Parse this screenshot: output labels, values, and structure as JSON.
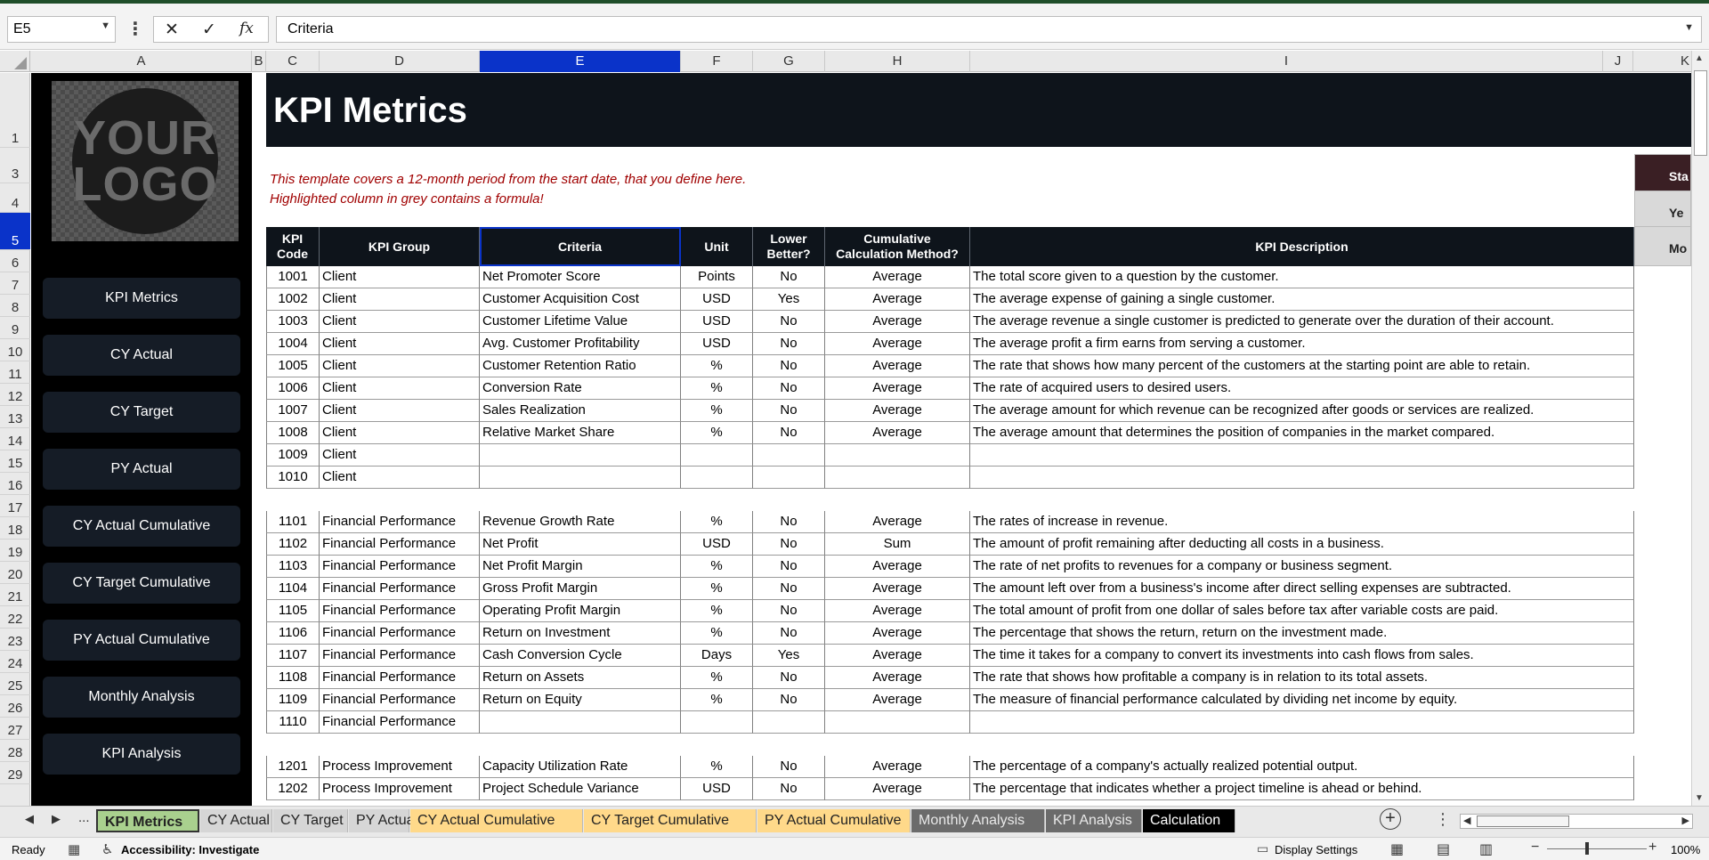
{
  "formula_bar": {
    "name_box": "E5",
    "formula": "Criteria"
  },
  "column_headers": [
    "A",
    "B",
    "C",
    "D",
    "E",
    "F",
    "G",
    "H",
    "I",
    "J",
    "K"
  ],
  "row_numbers": [
    "1",
    "3",
    "4",
    "5",
    "6",
    "7",
    "8",
    "9",
    "10",
    "11",
    "12",
    "13",
    "14",
    "15",
    "16",
    "17",
    "18",
    "19",
    "20",
    "21",
    "22",
    "23",
    "24",
    "25",
    "26",
    "27",
    "28",
    "29"
  ],
  "sidebar": {
    "logo_line1": "YOUR",
    "logo_line2": "LOGO",
    "items": [
      "KPI Metrics",
      "CY Actual",
      "CY Target",
      "PY Actual",
      "CY Actual Cumulative",
      "CY Target Cumulative",
      "PY Actual Cumulative",
      "Monthly Analysis",
      "KPI Analysis"
    ]
  },
  "sheet": {
    "title": "KPI Metrics",
    "note1": "This template covers a 12-month period from the start date, that you define here.",
    "note2": "Highlighted column in grey contains a formula!",
    "side_panel": [
      "Sta",
      "Ye",
      "Mo"
    ]
  },
  "table": {
    "headers": {
      "code_line1": "KPI",
      "code_line2": "Code",
      "group": "KPI Group",
      "criteria": "Criteria",
      "unit": "Unit",
      "lower_line1": "Lower",
      "lower_line2": "Better?",
      "cum_line1": "Cumulative",
      "cum_line2": "Calculation Method?",
      "desc": "KPI Description"
    },
    "rows": [
      {
        "code": "1001",
        "group": "Client",
        "criteria": "Net Promoter Score",
        "unit": "Points",
        "lower": "No",
        "method": "Average",
        "desc": "The total score given to a question by the customer."
      },
      {
        "code": "1002",
        "group": "Client",
        "criteria": "Customer Acquisition Cost",
        "unit": "USD",
        "lower": "Yes",
        "method": "Average",
        "desc": "The average expense of gaining a single customer."
      },
      {
        "code": "1003",
        "group": "Client",
        "criteria": "Customer Lifetime Value",
        "unit": "USD",
        "lower": "No",
        "method": "Average",
        "desc": "The average revenue a single customer is predicted to generate over the duration of their account."
      },
      {
        "code": "1004",
        "group": "Client",
        "criteria": "Avg. Customer Profitability",
        "unit": "USD",
        "lower": "No",
        "method": "Average",
        "desc": "The average profit a firm earns from serving a customer."
      },
      {
        "code": "1005",
        "group": "Client",
        "criteria": "Customer Retention Ratio",
        "unit": "%",
        "lower": "No",
        "method": "Average",
        "desc": "The rate that shows how many percent of the customers at the starting point are able to retain."
      },
      {
        "code": "1006",
        "group": "Client",
        "criteria": "Conversion Rate",
        "unit": "%",
        "lower": "No",
        "method": "Average",
        "desc": "The rate of acquired users to desired users."
      },
      {
        "code": "1007",
        "group": "Client",
        "criteria": "Sales Realization",
        "unit": "%",
        "lower": "No",
        "method": "Average",
        "desc": "The average amount for which revenue can be recognized after goods or services are realized."
      },
      {
        "code": "1008",
        "group": "Client",
        "criteria": "Relative Market Share",
        "unit": "%",
        "lower": "No",
        "method": "Average",
        "desc": "The average amount that determines the position of companies in the market compared."
      },
      {
        "code": "1009",
        "group": "Client",
        "criteria": "",
        "unit": "",
        "lower": "",
        "method": "",
        "desc": ""
      },
      {
        "code": "1010",
        "group": "Client",
        "criteria": "",
        "unit": "",
        "lower": "",
        "method": "",
        "desc": ""
      },
      {
        "code": "",
        "group": "",
        "criteria": "",
        "unit": "",
        "lower": "",
        "method": "",
        "desc": ""
      },
      {
        "code": "1101",
        "group": "Financial Performance",
        "criteria": "Revenue Growth Rate",
        "unit": "%",
        "lower": "No",
        "method": "Average",
        "desc": "The rates of increase in revenue."
      },
      {
        "code": "1102",
        "group": "Financial Performance",
        "criteria": "Net Profit",
        "unit": "USD",
        "lower": "No",
        "method": "Sum",
        "desc": "The amount of profit remaining after deducting all costs in a business."
      },
      {
        "code": "1103",
        "group": "Financial Performance",
        "criteria": "Net Profit Margin",
        "unit": "%",
        "lower": "No",
        "method": "Average",
        "desc": "The rate of net profits to revenues for a company or business segment."
      },
      {
        "code": "1104",
        "group": "Financial Performance",
        "criteria": "Gross Profit Margin",
        "unit": "%",
        "lower": "No",
        "method": "Average",
        "desc": "The amount left over from a business's income after direct selling expenses are subtracted."
      },
      {
        "code": "1105",
        "group": "Financial Performance",
        "criteria": "Operating Profit Margin",
        "unit": "%",
        "lower": "No",
        "method": "Average",
        "desc": "The total amount of profit from one dollar of sales before tax after variable costs are paid."
      },
      {
        "code": "1106",
        "group": "Financial Performance",
        "criteria": "Return on Investment",
        "unit": "%",
        "lower": "No",
        "method": "Average",
        "desc": "The percentage that shows the return, return on the investment made."
      },
      {
        "code": "1107",
        "group": "Financial Performance",
        "criteria": "Cash Conversion Cycle",
        "unit": "Days",
        "lower": "Yes",
        "method": "Average",
        "desc": "The time it takes for a company to convert its investments into cash flows from sales."
      },
      {
        "code": "1108",
        "group": "Financial Performance",
        "criteria": "Return on Assets",
        "unit": "%",
        "lower": "No",
        "method": "Average",
        "desc": "The rate that shows how profitable a company is in relation to its total assets."
      },
      {
        "code": "1109",
        "group": "Financial Performance",
        "criteria": "Return on Equity",
        "unit": "%",
        "lower": "No",
        "method": "Average",
        "desc": "The measure of financial performance calculated by dividing net income by equity."
      },
      {
        "code": "1110",
        "group": "Financial Performance",
        "criteria": "",
        "unit": "",
        "lower": "",
        "method": "",
        "desc": ""
      },
      {
        "code": "",
        "group": "",
        "criteria": "",
        "unit": "",
        "lower": "",
        "method": "",
        "desc": ""
      },
      {
        "code": "1201",
        "group": "Process Improvement",
        "criteria": "Capacity Utilization Rate",
        "unit": "%",
        "lower": "No",
        "method": "Average",
        "desc": "The percentage of a company's actually realized potential output."
      },
      {
        "code": "1202",
        "group": "Process Improvement",
        "criteria": "Project Schedule Variance",
        "unit": "USD",
        "lower": "No",
        "method": "Average",
        "desc": "The percentage that indicates whether a project timeline is ahead or behind."
      }
    ]
  },
  "tabs": {
    "ellipsis": "...",
    "items": [
      {
        "label": "KPI Metrics",
        "bg": "#a9d08e",
        "active": true
      },
      {
        "label": "CY Actual",
        "bg": "#d6d6d6"
      },
      {
        "label": "CY Target",
        "bg": "#d6d6d6"
      },
      {
        "label": "PY Actual",
        "bg": "#d6d6d6"
      },
      {
        "label": "CY Actual Cumulative",
        "bg": "#ffd98a"
      },
      {
        "label": "CY Target Cumulative",
        "bg": "#ffd98a"
      },
      {
        "label": "PY Actual Cumulative",
        "bg": "#ffd98a"
      },
      {
        "label": "Monthly Analysis",
        "bg": "#6b6b6b"
      },
      {
        "label": "KPI Analysis",
        "bg": "#6b6b6b"
      },
      {
        "label": "Calculation",
        "bg": "#000000",
        "fg": "#ffffff"
      }
    ]
  },
  "status": {
    "ready": "Ready",
    "accessibility": "Accessibility: Investigate",
    "display_settings": "Display Settings",
    "zoom": "100%"
  },
  "colors": {
    "header_bg": "#0e141b",
    "selection": "#0a33c9",
    "note": "#a00000"
  }
}
